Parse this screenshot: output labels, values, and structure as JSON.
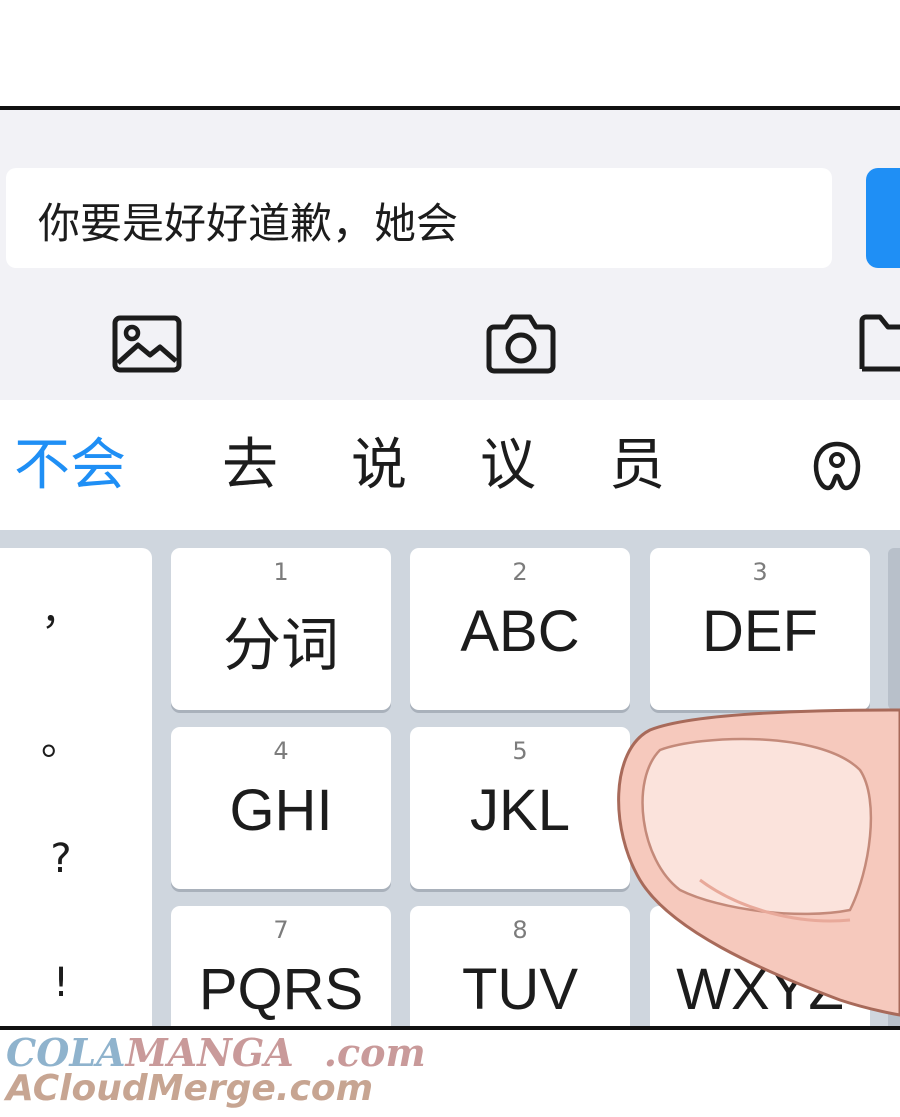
{
  "input": {
    "value": "你要是好好道歉，她会"
  },
  "toolbar": {
    "icons": [
      "image-icon",
      "camera-icon",
      "folder-icon"
    ]
  },
  "candidates": {
    "items": [
      "不会",
      "去",
      "说",
      "议",
      "员"
    ],
    "highlight_color": "#1f8ff5",
    "icon": "keyboard-logo-icon"
  },
  "keyboard": {
    "punctuation": [
      "，",
      "。",
      "?",
      "!"
    ],
    "keys": [
      {
        "num": "1",
        "label": "分词"
      },
      {
        "num": "2",
        "label": "ABC"
      },
      {
        "num": "3",
        "label": "DEF"
      },
      {
        "num": "4",
        "label": "GHI"
      },
      {
        "num": "5",
        "label": "JKL"
      },
      {
        "num": "7",
        "label": "PQRS"
      },
      {
        "num": "8",
        "label": "TUV"
      },
      {
        "num": "",
        "label": "WXYZ"
      }
    ]
  },
  "watermark": {
    "line1_a": "COLA",
    "line1_b": "MANGA",
    "line1_c": ".com",
    "line2": "ACloudMerge.com"
  },
  "colors": {
    "accent": "#1f8ff5",
    "keyboard_bg": "#cfd6de",
    "finger": "#f6c9bd"
  }
}
